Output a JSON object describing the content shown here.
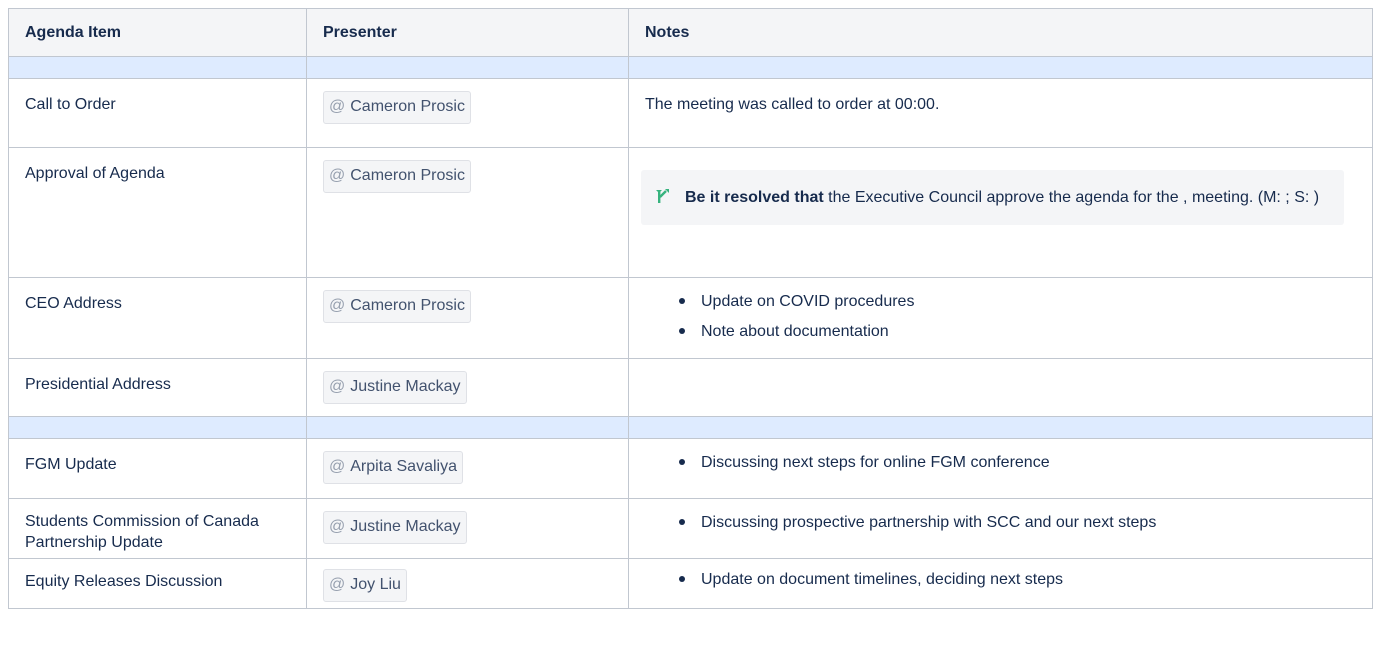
{
  "headers": [
    "Agenda Item",
    "Presenter",
    "Notes"
  ],
  "rows": [
    {
      "item": "Call to Order",
      "presenter": "Cameron Prosic",
      "notes_text": "The meeting was called to order at 00:00."
    },
    {
      "item": "Approval of Agenda",
      "presenter": "Cameron Prosic",
      "motion": {
        "bold": "Be it resolved that",
        "text": " the Executive Council approve the agenda for the , meeting. (M: ; S: )",
        "icon": "branch-icon",
        "icon_color": "#36b37e"
      }
    },
    {
      "item": "CEO Address",
      "presenter": "Cameron Prosic",
      "bullets": [
        "Update on COVID procedures",
        "Note about documentation"
      ]
    },
    {
      "item": "Presidential Address",
      "presenter": "Justine Mackay"
    },
    {
      "item": "FGM Update",
      "presenter": "Arpita Savaliya",
      "bullets": [
        "Discussing next steps for online FGM conference"
      ]
    },
    {
      "item": "Students Commission of Canada Partnership Update",
      "presenter": "Justine Mackay",
      "bullets": [
        "Discussing prospective partnership with SCC and our next steps"
      ]
    },
    {
      "item": "Equity Releases Discussion",
      "presenter": "Joy Liu",
      "bullets": [
        "Update on document timelines, deciding next steps"
      ]
    }
  ],
  "mention_prefix": "@",
  "colors": {
    "header_bg": "#f4f5f7",
    "spacer_bg": "#deebff",
    "border": "#c1c7d0",
    "mention_bg": "#f4f5f7"
  }
}
